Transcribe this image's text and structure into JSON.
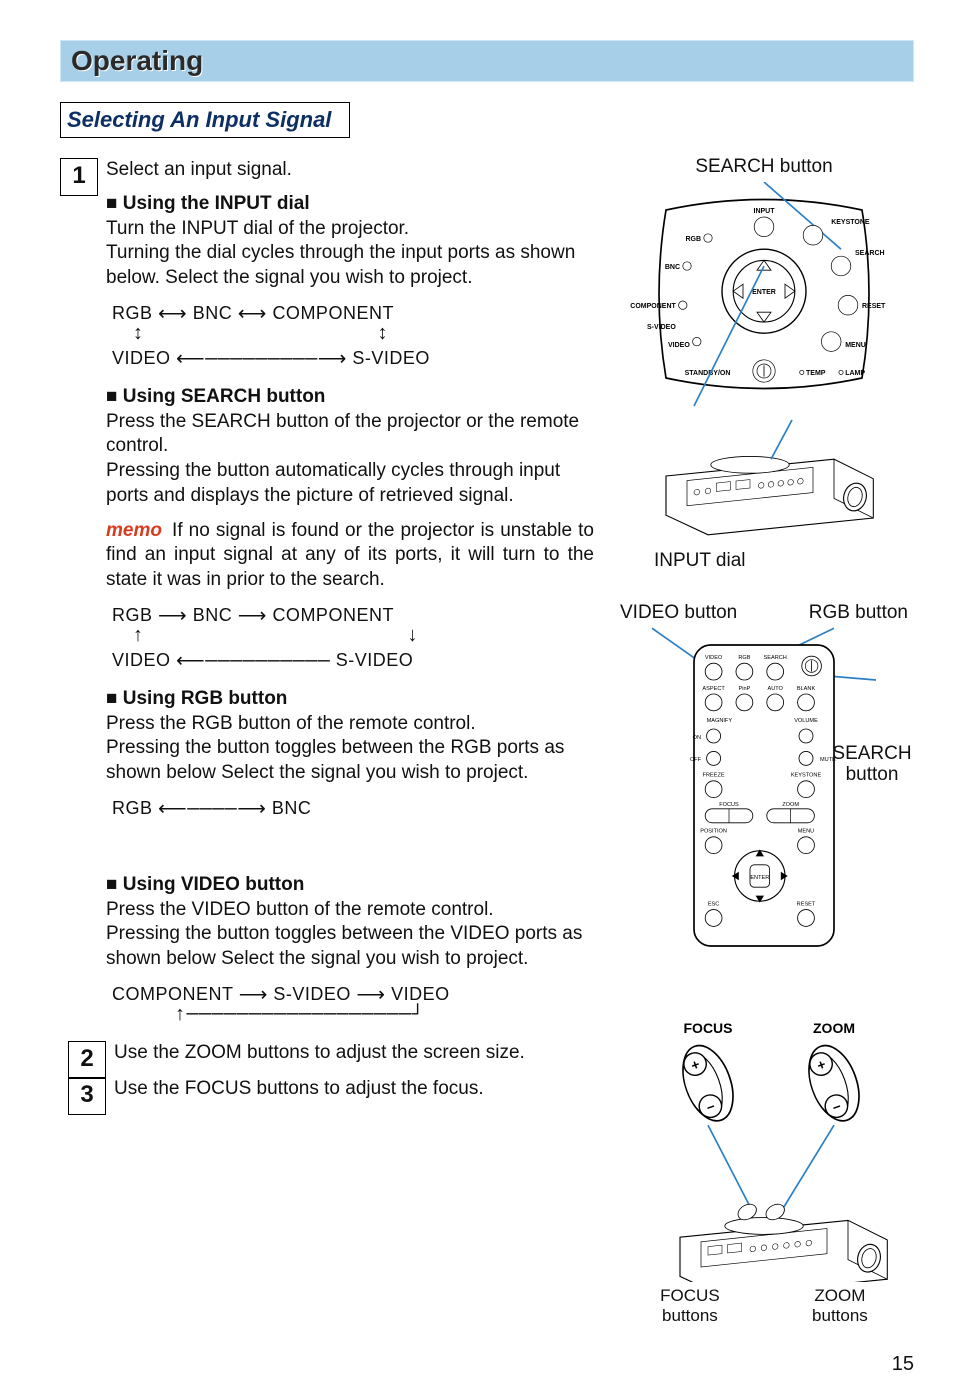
{
  "header": {
    "title": "Operating"
  },
  "subsection": "Selecting An Input Signal",
  "step1": {
    "num": "1",
    "intro": "Select an input signal.",
    "method1": {
      "heading": "Using the INPUT dial",
      "body": "Turn the INPUT dial of the projector.\nTurning the dial cycles through the input ports as shown below. Select the signal you wish to project.",
      "flow": {
        "row1": {
          "a": "RGB",
          "b": "BNC",
          "c": "COMPONENT"
        },
        "row2": {
          "a": "VIDEO",
          "b": "S-VIDEO"
        }
      }
    },
    "method2": {
      "heading": "Using SEARCH button",
      "body": "Press the SEARCH button of the projector or the remote control.\nPressing the button automatically cycles through input ports and displays the picture of retrieved signal.",
      "memo_label": "memo",
      "memo_body": "If no signal is found or the projector is unstable to find an input signal at any of its ports, it will turn to the state it was in prior to the search.",
      "flow": {
        "row1": {
          "a": "RGB",
          "b": "BNC",
          "c": "COMPONENT"
        },
        "row2": {
          "a": "VIDEO",
          "b": "S-VIDEO"
        }
      }
    },
    "method3": {
      "heading": "Using RGB button",
      "body": "Press the RGB button of the remote control.\nPressing the button toggles between the RGB ports as shown below Select the signal you wish to project.",
      "flow": {
        "a": "RGB",
        "b": "BNC"
      }
    },
    "method4": {
      "heading": "Using VIDEO button",
      "body": "Press the VIDEO button of the remote control.\nPressing the button toggles between the VIDEO ports as shown below Select the signal you wish to project.",
      "flow": {
        "a": "COMPONENT",
        "b": "S-VIDEO",
        "c": "VIDEO"
      }
    }
  },
  "step2": {
    "num": "2",
    "body": "Use the ZOOM buttons to adjust the screen size."
  },
  "step3": {
    "num": "3",
    "body": "Use the FOCUS buttons to adjust the focus."
  },
  "fig1": {
    "top_callout": "SEARCH button",
    "bottom_callout": "INPUT dial",
    "labels": {
      "input": "INPUT",
      "keystone": "KEYSTONE",
      "rgb": "RGB",
      "search": "SEARCH",
      "bnc": "BNC",
      "enter": "ENTER",
      "reset": "RESET",
      "component": "COMPONENT",
      "svideo": "S-VIDEO",
      "menu": "MENU",
      "video": "VIDEO",
      "standby": "STANDBY/ON",
      "temp": "TEMP",
      "lamp": "LAMP"
    }
  },
  "fig2": {
    "callouts": {
      "video": "VIDEO button",
      "rgb": "RGB button",
      "search": "SEARCH button"
    },
    "labels": {
      "video": "VIDEO",
      "rgb": "RGB",
      "search": "SEARCH",
      "aspect": "ASPECT",
      "pinp": "PinP",
      "auto": "AUTO",
      "blank": "BLANK",
      "magnify": "MAGNIFY",
      "on": "ON",
      "off": "OFF",
      "volume": "VOLUME",
      "mute": "MUTE",
      "freeze": "FREEZE",
      "keystone": "KEYSTONE",
      "focus": "FOCUS",
      "zoom": "ZOOM",
      "position": "POSITION",
      "menu": "MENU",
      "enter": "ENTER",
      "esc": "ESC",
      "reset": "RESET"
    }
  },
  "fig3": {
    "focus": "FOCUS",
    "zoom": "ZOOM",
    "focus_callout": "FOCUS buttons",
    "zoom_callout": "ZOOM buttons"
  },
  "page_number": "15"
}
